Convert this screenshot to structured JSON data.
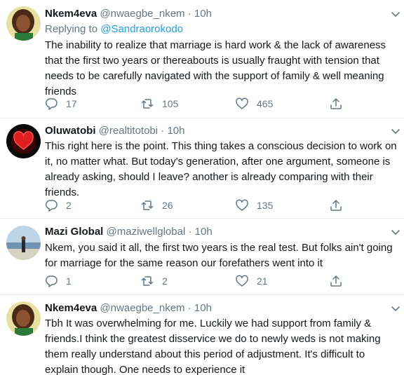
{
  "tweets": [
    {
      "name": "Nkem4eva",
      "handle": "@nwaegbe_nkem",
      "dot": "·",
      "time": "10h",
      "reply_prefix": "Replying to ",
      "reply_to": "@Sandraorokodo",
      "text": "The inability to realize that marriage is hard work & the lack of awareness that the first two years or thereabouts is usually fraught with tension that needs to be carefully navigated with the support of family & well meaning friends",
      "replies": "17",
      "retweets": "105",
      "likes": "465",
      "avatar": "nkem-avatar"
    },
    {
      "name": "Oluwatobi",
      "handle": "@realtitotobi",
      "dot": "·",
      "time": "10h",
      "text": "This right here is the point. This thing takes a conscious decision to work on it, no matter what. But today's generation, after one argument, someone is already asking, should I leave? another is already comparing with their friends.",
      "replies": "2",
      "retweets": "26",
      "likes": "135",
      "avatar": "red-heart-avatar"
    },
    {
      "name": "Mazi Global",
      "handle": "@maziwellglobal",
      "dot": "·",
      "time": "10h",
      "text": "Nkem, you said it all, the first two years is the real test. But folks ain't going for marriage for the same reason our forefathers went into it",
      "replies": "1",
      "retweets": "2",
      "likes": "21",
      "avatar": "beach-photo-avatar"
    },
    {
      "name": "Nkem4eva",
      "handle": "@nwaegbe_nkem",
      "dot": "·",
      "time": "10h",
      "text": "Tbh It was overwhelming for me. Luckily we had support from family & friends.I think the greatest disservice we do to newly weds is not making them really understand about this period of adjustment. It's difficult to explain though. One needs to experience it",
      "avatar": "nkem-avatar"
    }
  ],
  "colors": {
    "text": "#14171a",
    "secondary": "#657786",
    "accent": "#1da1f2",
    "divider": "#e6ecf0"
  },
  "icons": [
    "reply-icon",
    "retweet-icon",
    "like-icon",
    "share-icon",
    "chevron-down-icon"
  ]
}
